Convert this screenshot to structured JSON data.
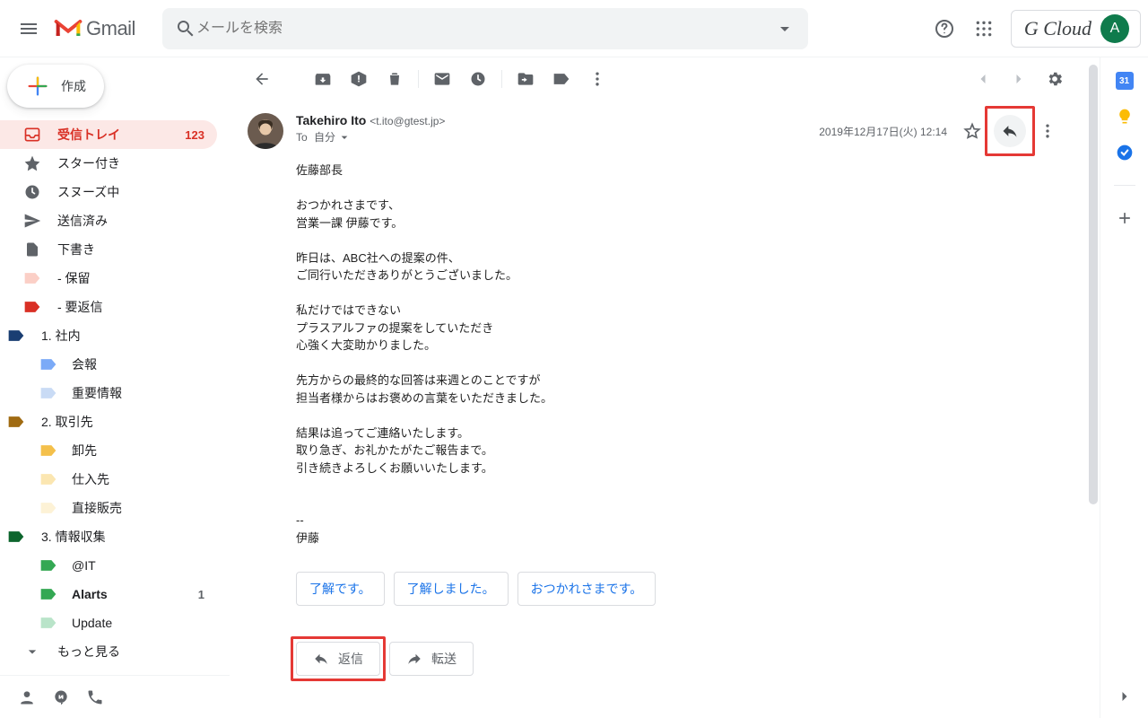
{
  "header": {
    "product_name": "Gmail",
    "search_placeholder": "メールを検索",
    "brand": "G Cloud",
    "avatar_letter": "A"
  },
  "sidebar": {
    "compose_label": "作成",
    "items": [
      {
        "label": "受信トレイ",
        "count": "123"
      },
      {
        "label": "スター付き"
      },
      {
        "label": "スヌーズ中"
      },
      {
        "label": "送信済み"
      },
      {
        "label": "下書き"
      },
      {
        "label": "- 保留"
      },
      {
        "label": "- 要返信"
      },
      {
        "label": "1. 社内"
      },
      {
        "label": "会報"
      },
      {
        "label": "重要情報"
      },
      {
        "label": "2. 取引先"
      },
      {
        "label": "卸先"
      },
      {
        "label": "仕入先"
      },
      {
        "label": "直接販売"
      },
      {
        "label": "3. 情報収集"
      },
      {
        "label": "@IT"
      },
      {
        "label": "Alarts",
        "count": "1"
      },
      {
        "label": "Update"
      },
      {
        "label": "もっと見る"
      }
    ]
  },
  "message": {
    "sender_name": "Takehiro Ito",
    "sender_email": "<t.ito@gtest.jp>",
    "recipient_prefix": "To",
    "recipient": "自分",
    "date": "2019年12月17日(火) 12:14",
    "body": "佐藤部長\n\nおつかれさまです、\n営業一課 伊藤です。\n\n昨日は、ABC社への提案の件、\nご同行いただきありがとうございました。\n\n私だけではできない\nプラスアルファの提案をしていただき\n心強く大変助かりました。\n\n先方からの最終的な回答は来週とのことですが\n担当者様からはお褒めの言葉をいただきました。\n\n結果は追ってご連絡いたします。\n取り急ぎ、お礼かたがたご報告まで。\n引き続きよろしくお願いいたします。\n\n\n--\n伊藤",
    "smart_replies": [
      "了解です。",
      "了解しました。",
      "おつかれさまです。"
    ],
    "reply_label": "返信",
    "forward_label": "転送"
  }
}
